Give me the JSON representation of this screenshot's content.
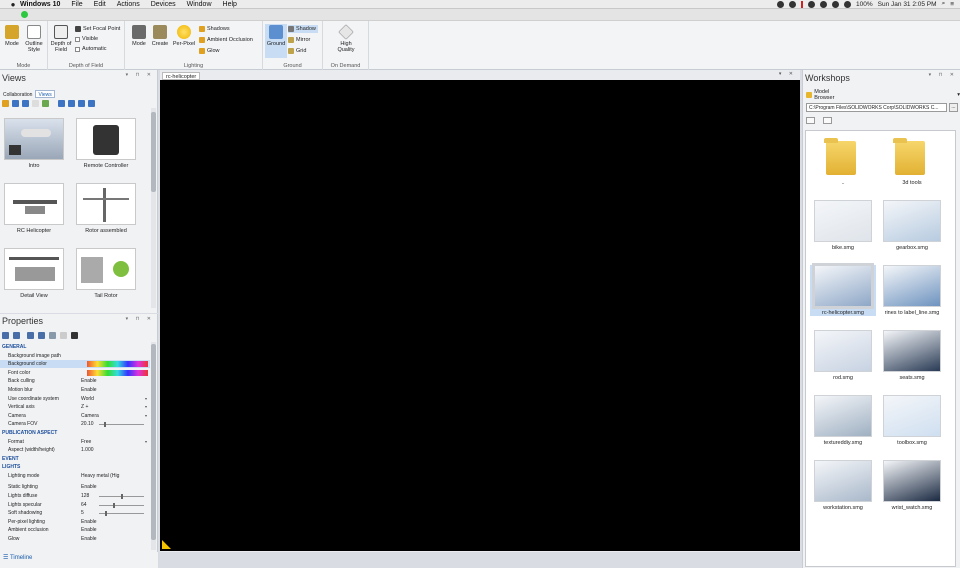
{
  "menubar": {
    "apple": "",
    "app": "Windows 10",
    "items": [
      "File",
      "Edit",
      "Actions",
      "Devices",
      "Window",
      "Help"
    ],
    "battery": "100%",
    "datetime": "Sun Jan 31  2:05 PM"
  },
  "ribbon": {
    "mode": {
      "title": "Mode",
      "buttons": [
        "Mode",
        "Outline Style"
      ]
    },
    "dof": {
      "title": "Depth of Field",
      "big": "Depth of Field",
      "small": [
        "Set Focal Point",
        "Visible",
        "Automatic"
      ]
    },
    "lighting": {
      "title": "Lighting",
      "big": [
        "Mode",
        "Create",
        "Per-Pixel"
      ],
      "small": [
        "Shadows",
        "Ambient Occlusion",
        "Glow"
      ]
    },
    "ground": {
      "title": "Ground",
      "big": "Ground",
      "small": [
        "Shadow",
        "Mirror",
        "Grid"
      ]
    },
    "ondemand": {
      "title": "On Demand",
      "big": "High Quality"
    }
  },
  "views": {
    "title": "Views",
    "tabs": [
      "Collaboration",
      "Views"
    ],
    "items": [
      "Intro",
      "Remote Controller",
      "RC Helicopter",
      "Rotor assembled",
      "Detail View",
      "Tail Rotor"
    ]
  },
  "properties": {
    "title": "Properties",
    "rows": [
      {
        "k": "GENERAL",
        "v": "",
        "sec": true
      },
      {
        "k": "Background image path",
        "v": ""
      },
      {
        "k": "Background color",
        "v": ""
      },
      {
        "k": "Font color",
        "v": ""
      },
      {
        "k": "Back culling",
        "v": "Enable"
      },
      {
        "k": "Motion blur",
        "v": "Enable"
      },
      {
        "k": "Use coordinate system",
        "v": "World"
      },
      {
        "k": "Vertical axis",
        "v": "Z +"
      },
      {
        "k": "Camera",
        "v": "Camera"
      },
      {
        "k": "Camera FOV",
        "v": "20.10"
      },
      {
        "k": "PUBLICATION ASPECT",
        "v": "",
        "sec": true
      },
      {
        "k": "Format",
        "v": "Free"
      },
      {
        "k": "Aspect (width/height)",
        "v": "1.000"
      },
      {
        "k": "EVENT",
        "v": "",
        "sec": true
      },
      {
        "k": "LIGHTS",
        "v": "",
        "sec": true
      },
      {
        "k": "Lighting mode",
        "v": "Heavy metal (Hig"
      },
      {
        "k": "Static lighting",
        "v": "Enable"
      },
      {
        "k": "Lights diffuse",
        "v": "128"
      },
      {
        "k": "Lights specular",
        "v": "64"
      },
      {
        "k": "Soft shadowing",
        "v": "5"
      },
      {
        "k": "Per-pixel lighting",
        "v": "Enable"
      },
      {
        "k": "Ambient occlusion",
        "v": "Enable"
      },
      {
        "k": "Glow",
        "v": "Enable"
      }
    ]
  },
  "timeline": {
    "label": "Timeline"
  },
  "viewport": {
    "tab": "rc-helicopter"
  },
  "workshops": {
    "title": "Workshops",
    "browser": "Model Browser",
    "path": "C:\\Program Files\\SOLIDWORKS Corp\\SOLIDWORKS C...",
    "browse": "...",
    "items": [
      "..",
      "3d tools",
      "bike.smg",
      "gearbox.smg",
      "rc-helicopter.smg",
      "rines to label_line.smg",
      "rod.smg",
      "seats.smg",
      "textureddiy.smg",
      "toolbox.smg",
      "workstation.smg",
      "wrist_watch.smg"
    ]
  }
}
